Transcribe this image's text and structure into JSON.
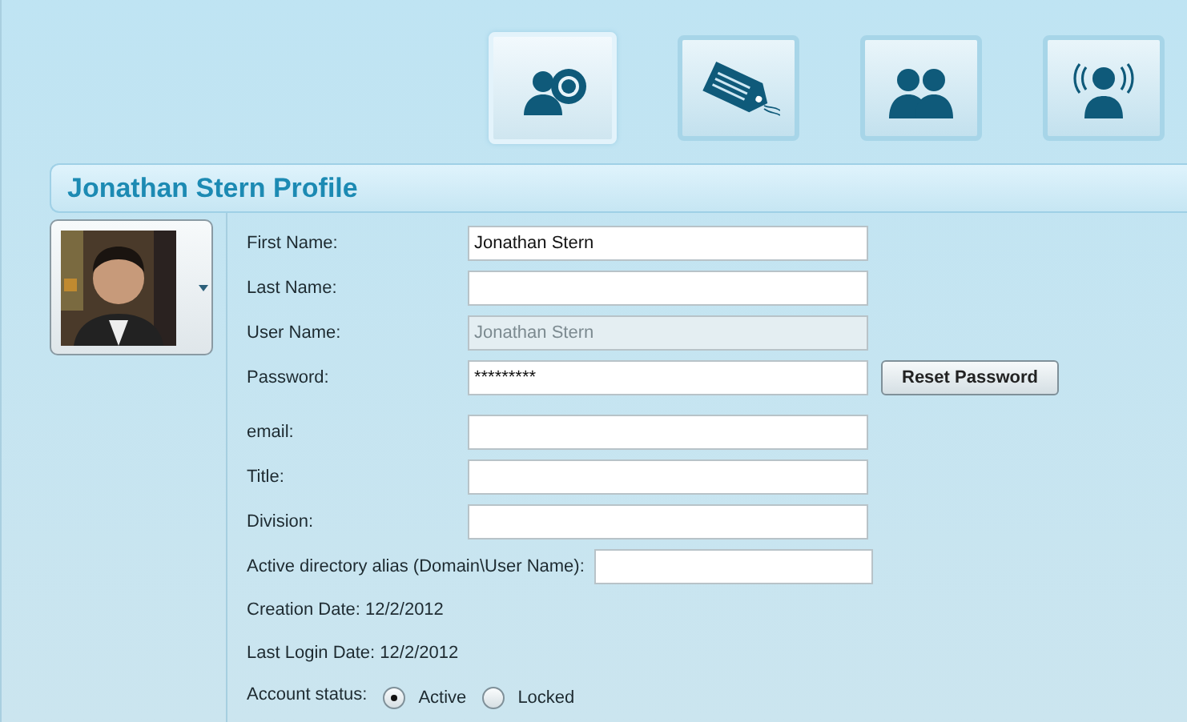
{
  "toolbar": [
    {
      "kind": "user_settings",
      "selected": true
    },
    {
      "kind": "tag",
      "selected": false
    },
    {
      "kind": "users",
      "selected": false
    },
    {
      "kind": "broadcast",
      "selected": false
    }
  ],
  "header": {
    "title": "Jonathan Stern Profile"
  },
  "form": [
    {
      "kind": "input",
      "label": "First Name:",
      "value": "Jonathan Stern",
      "disabled": false
    },
    {
      "kind": "input",
      "label": "Last Name:",
      "disabled": false
    },
    {
      "kind": "input",
      "label": "User Name:",
      "value": "Jonathan Stern",
      "disabled": true
    },
    {
      "kind": "password",
      "label": "Password:",
      "value": "*********",
      "button": "Reset Password"
    },
    {
      "kind": "input",
      "label": "email:",
      "disabled": false
    },
    {
      "kind": "input",
      "label": "Title:",
      "disabled": false
    },
    {
      "kind": "input",
      "label": "Division:",
      "disabled": false
    },
    {
      "kind": "inline_input",
      "label": "Active directory alias (Domain\\User Name):"
    },
    {
      "kind": "text",
      "text": "Creation Date: 12/2/2012"
    },
    {
      "kind": "text",
      "text": "Last Login Date: 12/2/2012"
    },
    {
      "kind": "radio",
      "label": "Account status:",
      "options": [
        {
          "label": "Active",
          "selected": true
        },
        {
          "label": "Locked",
          "selected": false
        }
      ]
    }
  ]
}
